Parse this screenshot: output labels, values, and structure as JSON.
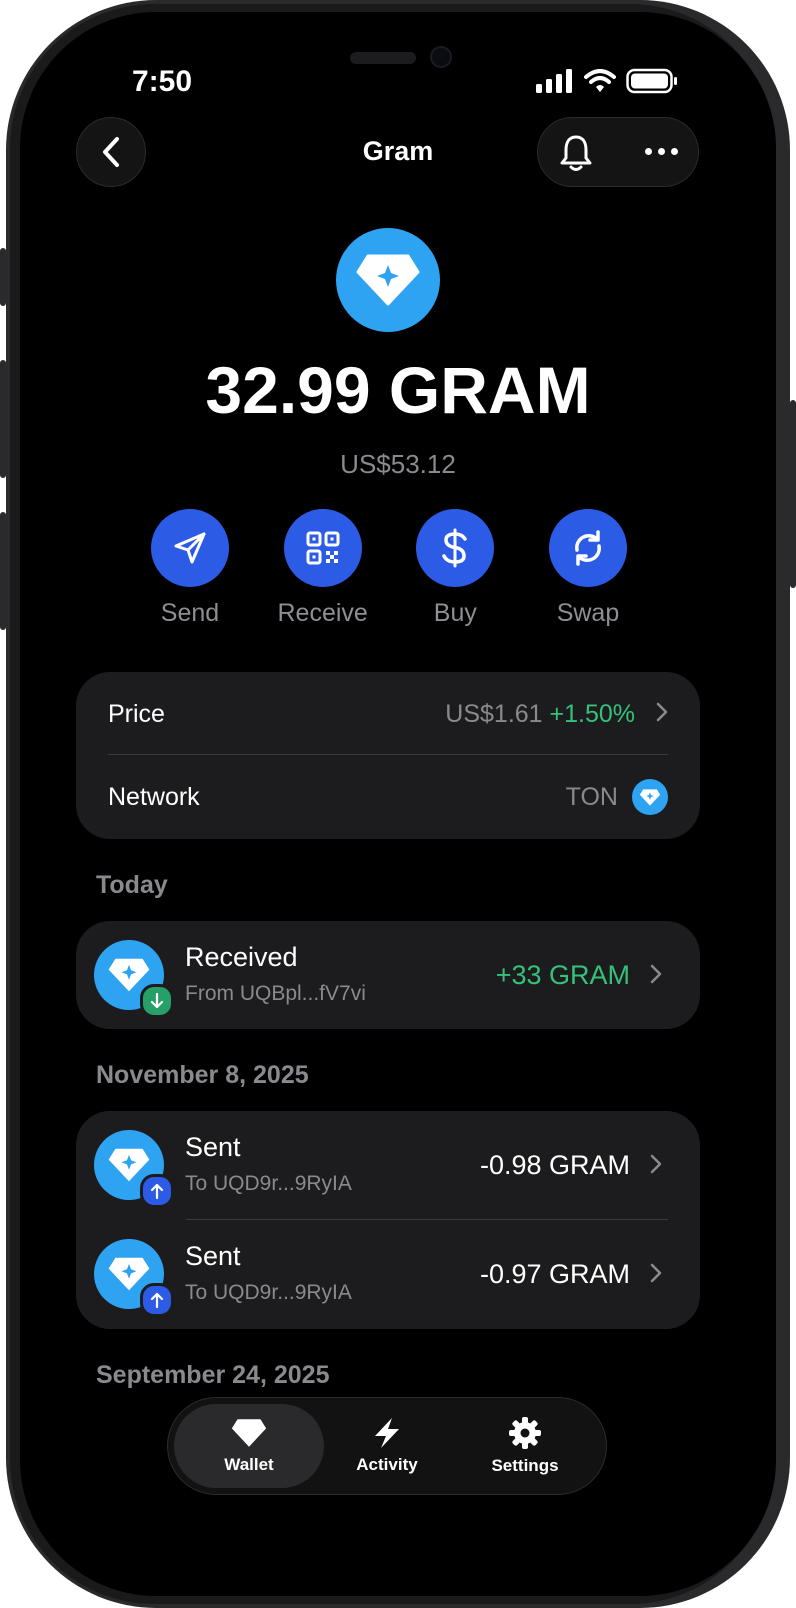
{
  "status_bar": {
    "time": "7:50"
  },
  "header": {
    "title": "Gram"
  },
  "token": {
    "balance": "32.99 GRAM",
    "fiat_value": "US$53.12",
    "brand_color": "#2ea3f2"
  },
  "actions": [
    {
      "label": "Send",
      "icon": "send-icon"
    },
    {
      "label": "Receive",
      "icon": "qr-code-icon"
    },
    {
      "label": "Buy",
      "icon": "dollar-icon"
    },
    {
      "label": "Swap",
      "icon": "swap-icon"
    }
  ],
  "info": {
    "price_label": "Price",
    "price_value": "US$1.61",
    "price_change": "+1.50%",
    "network_label": "Network",
    "network_value": "TON"
  },
  "history": {
    "groups": [
      {
        "date": "Today",
        "items": [
          {
            "title": "Received",
            "subtitle": "From UQBpl...fV7vi",
            "amount": "+33 GRAM",
            "direction": "in"
          }
        ]
      },
      {
        "date": "November 8, 2025",
        "items": [
          {
            "title": "Sent",
            "subtitle": "To UQD9r...9RyIA",
            "amount": "-0.98 GRAM",
            "direction": "out"
          },
          {
            "title": "Sent",
            "subtitle": "To UQD9r...9RyIA",
            "amount": "-0.97 GRAM",
            "direction": "out"
          }
        ]
      },
      {
        "date": "September 24, 2025",
        "items": []
      }
    ]
  },
  "tabbar": {
    "tabs": [
      {
        "label": "Wallet",
        "icon": "wallet-gem-icon",
        "active": true
      },
      {
        "label": "Activity",
        "icon": "lightning-icon",
        "active": false
      },
      {
        "label": "Settings",
        "icon": "gear-icon",
        "active": false
      }
    ]
  },
  "colors": {
    "accent": "#2c5ce6",
    "positive": "#34c27a",
    "card": "#1c1c1e"
  }
}
